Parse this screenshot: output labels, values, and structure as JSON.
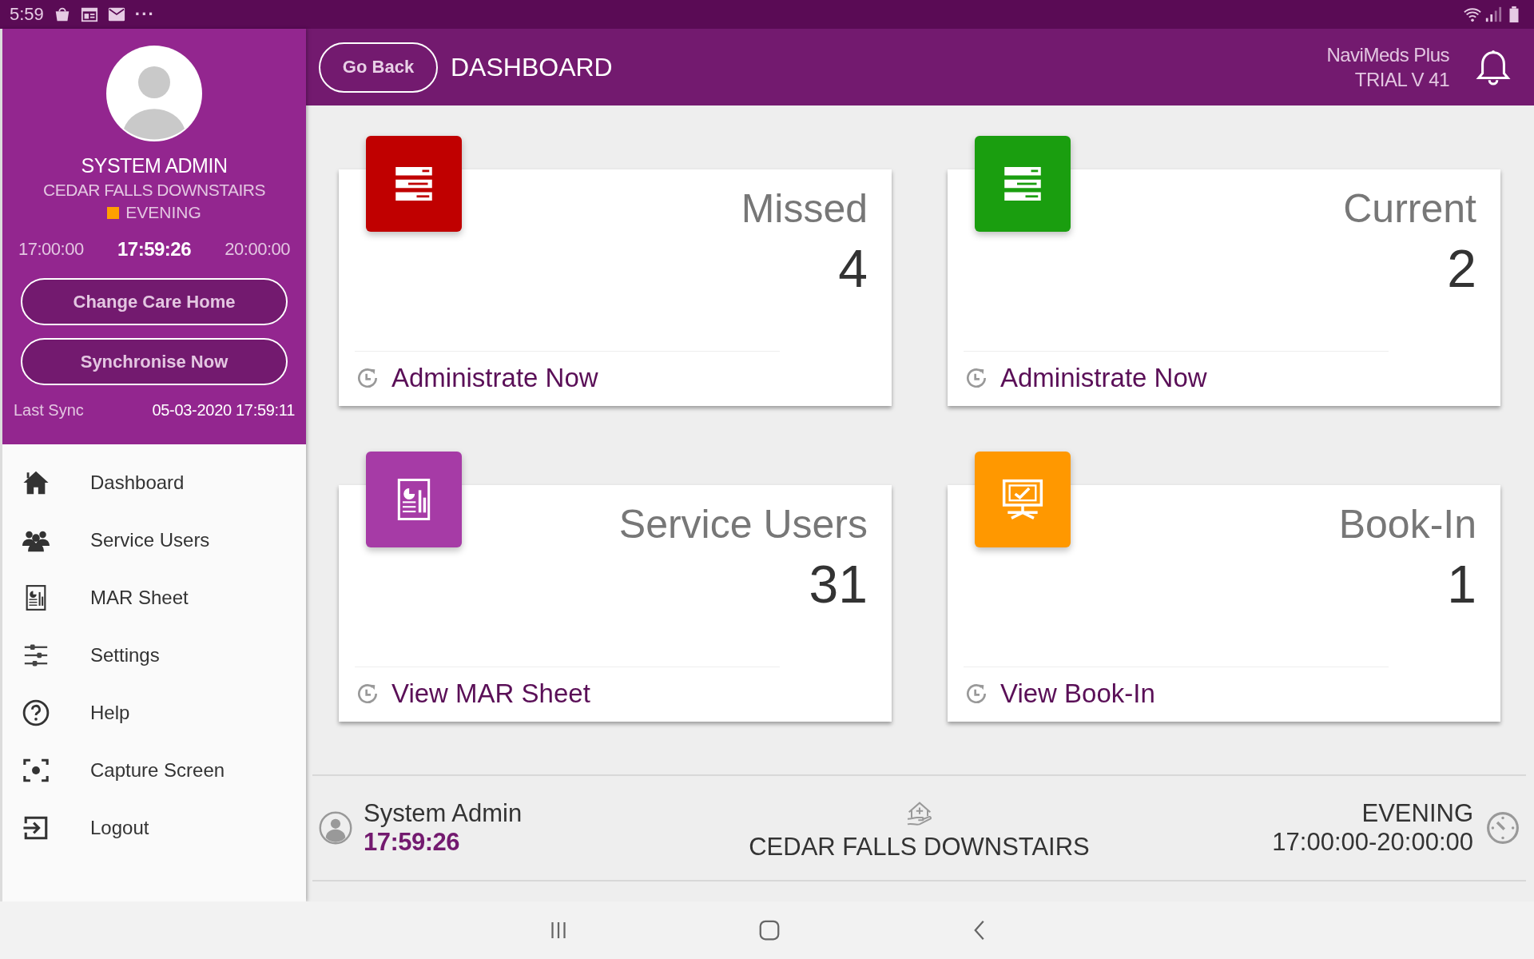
{
  "status_bar": {
    "time": "5:59",
    "more": "···"
  },
  "sidebar": {
    "profile": {
      "name": "SYSTEM ADMIN",
      "care_home": "CEDAR FALLS DOWNSTAIRS",
      "shift": {
        "label": "EVENING",
        "color": "#ffa000"
      },
      "start": "17:00:00",
      "now": "17:59:26",
      "end": "20:00:00"
    },
    "buttons": [
      "Change Care Home",
      "Synchronise Now"
    ],
    "last_sync": {
      "label": "Last Sync",
      "value": "05-03-2020 17:59:11"
    },
    "items": [
      {
        "label": "Dashboard",
        "kind": "home"
      },
      {
        "label": "Service Users",
        "kind": "users"
      },
      {
        "label": "MAR Sheet",
        "kind": "report"
      },
      {
        "label": "Settings",
        "kind": "sliders"
      },
      {
        "label": "Help",
        "kind": "help"
      },
      {
        "label": "Capture Screen",
        "kind": "capture"
      },
      {
        "label": "Logout",
        "kind": "logout"
      }
    ]
  },
  "header": {
    "back_button": "Go Back",
    "title": "DASHBOARD",
    "app_name": "NaviMeds Plus",
    "version": "TRIAL V 41"
  },
  "cards": [
    {
      "title": "Missed",
      "count": "4",
      "action": "Administrate Now",
      "color": "#c00000",
      "kind": "list"
    },
    {
      "title": "Current",
      "count": "2",
      "action": "Administrate Now",
      "color": "#1a9e0f",
      "kind": "list"
    },
    {
      "title": "Service Users",
      "count": "31",
      "action": "View MAR Sheet",
      "color": "#a63ba6",
      "kind": "report"
    },
    {
      "title": "Book-In",
      "count": "1",
      "action": "View Book-In",
      "color": "#ff9800",
      "kind": "monitor"
    }
  ],
  "footer": {
    "user": "System Admin",
    "time": "17:59:26",
    "care_home": "CEDAR FALLS DOWNSTAIRS",
    "shift": "EVENING",
    "range": "17:00:00-20:00:00"
  }
}
